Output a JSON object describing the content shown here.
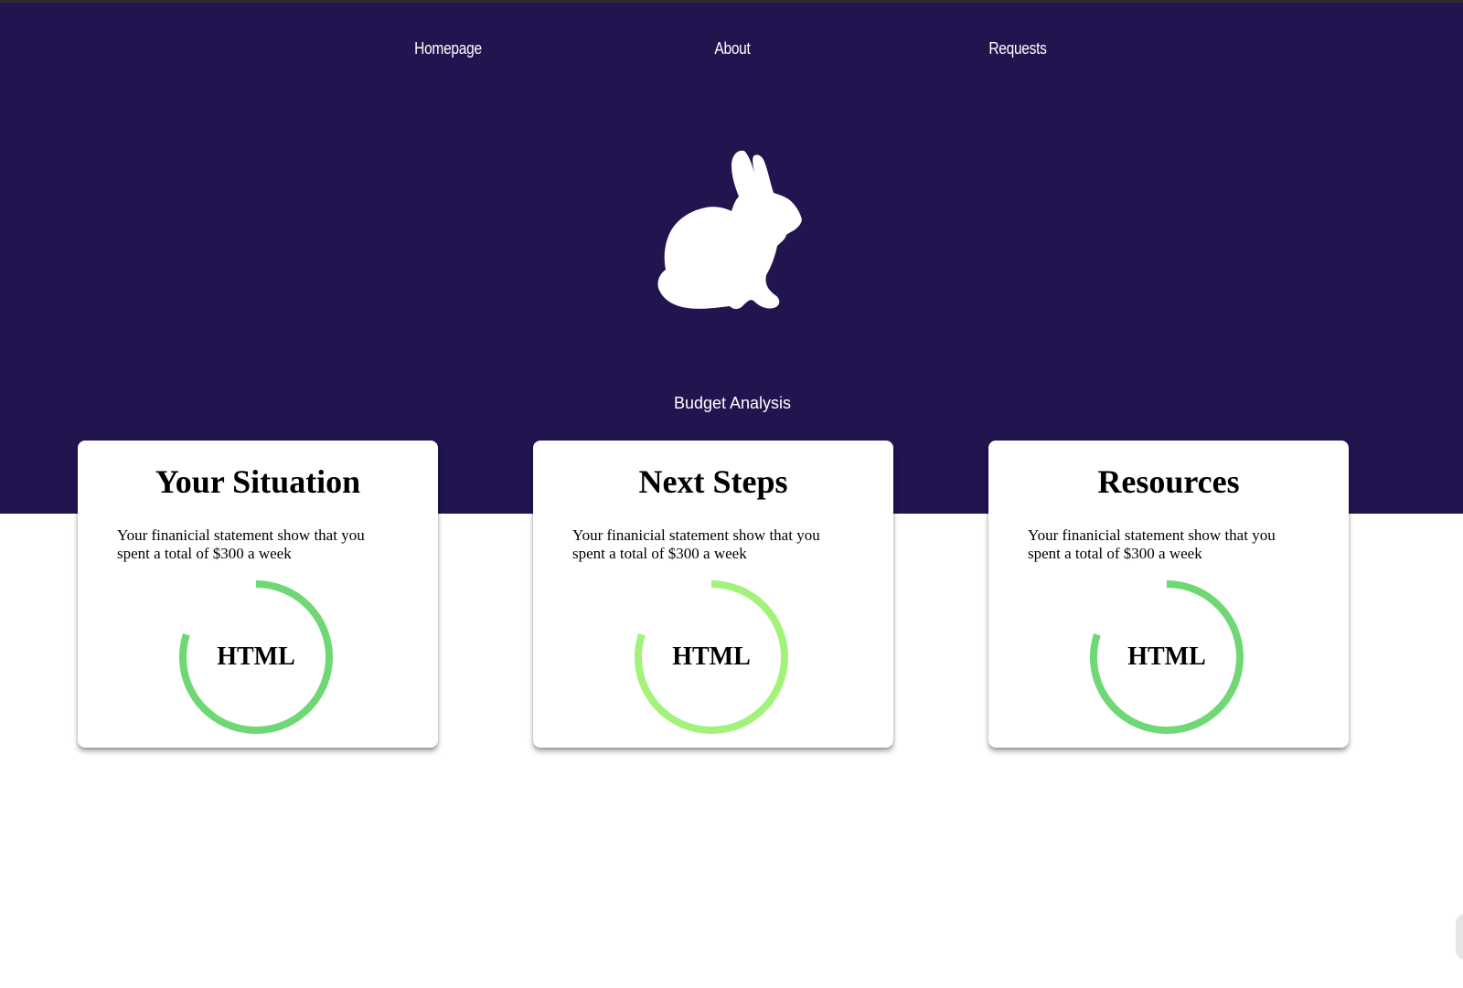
{
  "nav": {
    "items": [
      {
        "label": "Homepage"
      },
      {
        "label": "About"
      },
      {
        "label": "Requests"
      }
    ]
  },
  "logo": {
    "icon": "rabbit-icon"
  },
  "hero": {
    "subtitle": "Budget Analysis",
    "background_color": "#21144f"
  },
  "cards": [
    {
      "title": "Your Situation",
      "text": "Your finanicial statement show that you spent a total of $300 a week",
      "ring_label": "HTML",
      "ring_progress": 0.8,
      "ring_color": "#6fd874"
    },
    {
      "title": "Next Steps",
      "text": "Your finanicial statement show that you spent a total of $300 a week",
      "ring_label": "HTML",
      "ring_progress": 0.8,
      "ring_color": "#a3f27a"
    },
    {
      "title": "Resources",
      "text": "Your finanicial statement show that you spent a total of $300 a week",
      "ring_label": "HTML",
      "ring_progress": 0.8,
      "ring_color": "#6fd874"
    }
  ]
}
